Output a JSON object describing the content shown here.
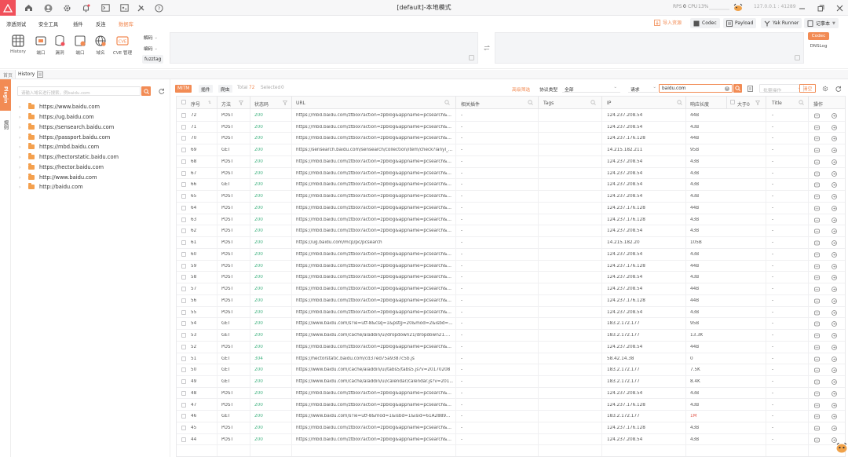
{
  "window": {
    "title": "[default]-本地模式",
    "rps_label": "RPS",
    "rps_value": "0",
    "cpu_label": "CPU",
    "cpu_value": "13%",
    "ip_port": "127.0.0.1 : 41289"
  },
  "menu": {
    "items": [
      "渗透测试",
      "安全工具",
      "插件",
      "反连",
      "数据库"
    ],
    "active_index": 4,
    "import_label": "导入资源",
    "codec_label": "Codec",
    "payload_label": "Payload",
    "yakrunner_label": "Yak Runner",
    "notebook_label": "记事本"
  },
  "toolbar": {
    "tools": [
      "History",
      "端口",
      "漏洞",
      "端口",
      "域名",
      "CVE 管理"
    ],
    "decode_label": "解码",
    "encode_label": "编码",
    "fuzztag_label": "fuzztag",
    "codec_btn": "Codec",
    "dnslog_btn": "DNSLog"
  },
  "tabs": {
    "first": "首页",
    "second": "History"
  },
  "sidebar": {
    "tab1": "Plugin",
    "tab2": "规则"
  },
  "tree": {
    "search_placeholder": "请输入域名进行搜索，例baidu.com",
    "items": [
      "https://www.baidu.com",
      "https://ug.baidu.com",
      "https://sensearch.baidu.com",
      "https://passport.baidu.com",
      "https://mbd.baidu.com",
      "https://hectorstatic.baidu.com",
      "https://hector.baidu.com",
      "http://www.baidu.com",
      "http://baidu.com"
    ]
  },
  "filters": {
    "mitm_label": "MITM",
    "plugin_label": "插件",
    "crawler_label": "爬虫",
    "total_label": "Total",
    "total_value": "72",
    "selected_label": "Selected",
    "selected_value": "0",
    "advanced_label": "高级筛选",
    "protocol_label": "协议类型",
    "protocol_value": "全部",
    "request_label": "请求",
    "search_value": "baidu.com",
    "batch_label": "批量操作",
    "clear_label": "清空"
  },
  "table": {
    "headers": [
      "序号",
      "方法",
      "状态码",
      "URL",
      "相关插件",
      "Tags",
      "IP",
      "响应长度",
      "大于0",
      "Title",
      "操作"
    ],
    "rows": [
      {
        "id": "72",
        "method": "POST",
        "status": "200",
        "url": "https://mbd.baidu.com/ztbox?action=zpblog&appname=pcsearch&...",
        "plugin": "-",
        "ip": "124.237.208.54",
        "len": "44B",
        "title": "-"
      },
      {
        "id": "71",
        "method": "POST",
        "status": "200",
        "url": "https://mbd.baidu.com/ztbox?action=zpblog&appname=pcsearch&...",
        "plugin": "-",
        "ip": "124.237.208.54",
        "len": "43B",
        "title": "-"
      },
      {
        "id": "70",
        "method": "POST",
        "status": "200",
        "url": "https://mbd.baidu.com/ztbox?action=zpblog&appname=pcsearch&...",
        "plugin": "-",
        "ip": "124.237.176.128",
        "len": "44B",
        "title": "-"
      },
      {
        "id": "69",
        "method": "GET",
        "status": "200",
        "url": "https://sensearch.baidu.com/sensearch/collection/item/check?lanyl_...",
        "plugin": "-",
        "ip": "14.215.182.211",
        "len": "95B",
        "title": "-"
      },
      {
        "id": "68",
        "method": "POST",
        "status": "200",
        "url": "https://mbd.baidu.com/ztbox?action=zpblog&appname=pcsearch&...",
        "plugin": "-",
        "ip": "124.237.208.54",
        "len": "43B",
        "title": "-"
      },
      {
        "id": "67",
        "method": "POST",
        "status": "200",
        "url": "https://mbd.baidu.com/ztbox?action=zpblog&appname=pcsearch&...",
        "plugin": "-",
        "ip": "124.237.208.54",
        "len": "43B",
        "title": "-"
      },
      {
        "id": "66",
        "method": "GET",
        "status": "200",
        "url": "https://mbd.baidu.com/ztbox?action=zpblog&appname=pcsearch&...",
        "plugin": "-",
        "ip": "124.237.208.54",
        "len": "43B",
        "title": "-"
      },
      {
        "id": "65",
        "method": "POST",
        "status": "200",
        "url": "https://mbd.baidu.com/ztbox?action=zpblog&appname=pcsearch&...",
        "plugin": "-",
        "ip": "124.237.208.54",
        "len": "43B",
        "title": "-"
      },
      {
        "id": "64",
        "method": "POST",
        "status": "200",
        "url": "https://mbd.baidu.com/ztbox?action=zpblog&appname=pcsearch&...",
        "plugin": "-",
        "ip": "124.237.176.128",
        "len": "44B",
        "title": "-"
      },
      {
        "id": "63",
        "method": "POST",
        "status": "200",
        "url": "https://mbd.baidu.com/ztbox?action=zpblog&appname=pcsearch&...",
        "plugin": "-",
        "ip": "124.237.176.128",
        "len": "43B",
        "title": "-"
      },
      {
        "id": "62",
        "method": "POST",
        "status": "200",
        "url": "https://mbd.baidu.com/ztbox?action=zpblog&appname=pcsearch&...",
        "plugin": "-",
        "ip": "124.237.208.54",
        "len": "43B",
        "title": "-"
      },
      {
        "id": "61",
        "method": "POST",
        "status": "200",
        "url": "https://ug.baidu.com/mcp/pc/pcsearch",
        "plugin": "-",
        "ip": "14.215.182.20",
        "len": "105B",
        "title": "-"
      },
      {
        "id": "60",
        "method": "POST",
        "status": "200",
        "url": "https://mbd.baidu.com/ztbox?action=zpblog&appname=pcsearch&...",
        "plugin": "-",
        "ip": "124.237.208.54",
        "len": "43B",
        "title": "-"
      },
      {
        "id": "59",
        "method": "POST",
        "status": "200",
        "url": "https://mbd.baidu.com/ztbox?action=zpblog&appname=pcsearch&...",
        "plugin": "-",
        "ip": "124.237.176.128",
        "len": "44B",
        "title": "-"
      },
      {
        "id": "58",
        "method": "POST",
        "status": "200",
        "url": "https://mbd.baidu.com/ztbox?action=zpblog&appname=pcsearch&...",
        "plugin": "-",
        "ip": "124.237.208.54",
        "len": "43B",
        "title": "-"
      },
      {
        "id": "57",
        "method": "POST",
        "status": "200",
        "url": "https://mbd.baidu.com/ztbox?action=zpblog&appname=pcsearch&...",
        "plugin": "-",
        "ip": "124.237.208.54",
        "len": "44B",
        "title": "-"
      },
      {
        "id": "56",
        "method": "POST",
        "status": "200",
        "url": "https://mbd.baidu.com/ztbox?action=zpblog&appname=pcsearch&...",
        "plugin": "-",
        "ip": "124.237.176.128",
        "len": "44B",
        "title": "-"
      },
      {
        "id": "55",
        "method": "POST",
        "status": "200",
        "url": "https://mbd.baidu.com/ztbox?action=zpblog&appname=pcsearch&...",
        "plugin": "-",
        "ip": "124.237.208.54",
        "len": "43B",
        "title": "-"
      },
      {
        "id": "54",
        "method": "GET",
        "status": "200",
        "url": "https://www.baidu.com/s?ie=utf-8&csq=1&pstg=20&mod=2&isbd=...",
        "plugin": "-",
        "ip": "183.2.172.177",
        "len": "95B",
        "title": "-"
      },
      {
        "id": "53",
        "method": "GET",
        "status": "200",
        "url": "https://www.baidu.com/cache/aladdin/ui/dropdown21/dropdown21....",
        "plugin": "-",
        "ip": "183.2.172.177",
        "len": "13.3K",
        "title": "-"
      },
      {
        "id": "52",
        "method": "POST",
        "status": "200",
        "url": "https://mbd.baidu.com/ztbox?action=zpblog&appname=pcsearch&...",
        "plugin": "-",
        "ip": "124.237.208.54",
        "len": "44B",
        "title": "-"
      },
      {
        "id": "51",
        "method": "GET",
        "status": "304",
        "url": "https://hectorstatic.baidu.com/cd37ed75a9387c5b.js",
        "plugin": "-",
        "ip": "58.42.14.38",
        "len": "0",
        "title": "-"
      },
      {
        "id": "50",
        "method": "GET",
        "status": "200",
        "url": "https://www.baidu.com/cache/aladdin/ui/tabs5/tabs5.js?v=20170208",
        "plugin": "-",
        "ip": "183.2.172.177",
        "len": "7.5K",
        "title": "-"
      },
      {
        "id": "49",
        "method": "GET",
        "status": "200",
        "url": "https://www.baidu.com/cache/aladdin/ui/calendar/calendar.js?v=201...",
        "plugin": "-",
        "ip": "183.2.172.177",
        "len": "8.4K",
        "title": "-"
      },
      {
        "id": "48",
        "method": "POST",
        "status": "200",
        "url": "https://mbd.baidu.com/ztbox?action=zpblog&appname=pcsearch&...",
        "plugin": "-",
        "ip": "124.237.208.54",
        "len": "43B",
        "title": "-"
      },
      {
        "id": "47",
        "method": "POST",
        "status": "200",
        "url": "https://mbd.baidu.com/ztbox?action=zpblog&appname=pcsearch&...",
        "plugin": "-",
        "ip": "124.237.176.128",
        "len": "43B",
        "title": "-"
      },
      {
        "id": "46",
        "method": "GET",
        "status": "200",
        "url": "https://www.baidu.com/s?ie=utf-8&mod=1&isbd=1&isid=61A2889...",
        "plugin": "-",
        "ip": "183.2.172.177",
        "len": "1M",
        "title": "-"
      },
      {
        "id": "45",
        "method": "POST",
        "status": "200",
        "url": "https://mbd.baidu.com/ztbox?action=zpblog&appname=pcsearch&...",
        "plugin": "-",
        "ip": "124.237.176.128",
        "len": "43B",
        "title": "-"
      },
      {
        "id": "44",
        "method": "POST",
        "status": "200",
        "url": "https://mbd.baidu.com/ztbox?action=zpblog&appname=pcsearch&...",
        "plugin": "-",
        "ip": "124.237.208.54",
        "len": "43B",
        "title": "-"
      }
    ]
  },
  "colors": {
    "accent": "#f28b54",
    "logo": "#f0505a",
    "status_ok": "#3fb27f",
    "large_response": "#e15a4e"
  }
}
